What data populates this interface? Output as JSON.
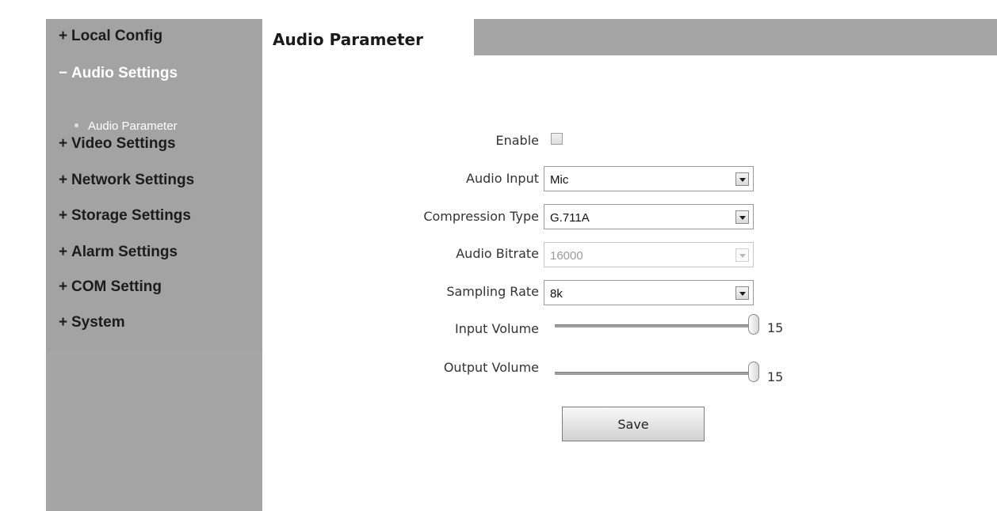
{
  "sidebar": {
    "items": [
      {
        "sign": "+",
        "label": "Local Config"
      },
      {
        "sign": "−",
        "label": "Audio Settings"
      },
      {
        "sign": "+",
        "label": "Video Settings"
      },
      {
        "sign": "+",
        "label": "Network Settings"
      },
      {
        "sign": "+",
        "label": "Storage Settings"
      },
      {
        "sign": "+",
        "label": "Alarm Settings"
      },
      {
        "sign": "+",
        "label": "COM Setting"
      },
      {
        "sign": "+",
        "label": "System"
      }
    ],
    "subitem": {
      "label": "Audio Parameter"
    }
  },
  "header": {
    "title": "Audio Parameter"
  },
  "form": {
    "enable": {
      "label": "Enable",
      "checked": false
    },
    "audio_input": {
      "label": "Audio Input",
      "value": "Mic"
    },
    "compression_type": {
      "label": "Compression Type",
      "value": "G.711A"
    },
    "audio_bitrate": {
      "label": "Audio Bitrate",
      "value": "16000",
      "disabled": true
    },
    "sampling_rate": {
      "label": "Sampling Rate",
      "value": "8k"
    },
    "input_volume": {
      "label": "Input Volume",
      "value": "15",
      "level": 1.0
    },
    "output_volume": {
      "label": "Output Volume",
      "value": "15",
      "level": 1.0
    },
    "save_label": "Save"
  },
  "colors": {
    "sidebar_bg": "#a6a6a6",
    "header_bg": "#a6a6a6",
    "active_text": "#ffffff"
  }
}
